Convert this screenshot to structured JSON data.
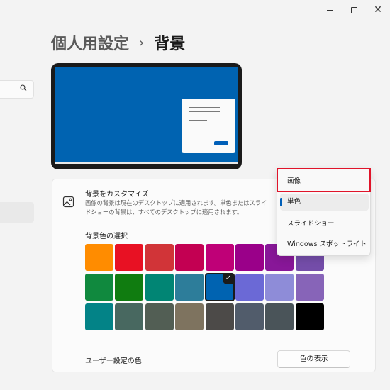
{
  "window": {
    "minimize_label": "",
    "close_glyph": "✕"
  },
  "header": {
    "parent": "個人用設定",
    "separator": "›",
    "current": "背景"
  },
  "customize": {
    "title": "背景をカスタマイズ",
    "description": "画像の背景は現在のデスクトップに適用されます。単色またはスライドショーの背景は、すべてのデスクトップに適用されます。",
    "icon": "image-icon"
  },
  "dropdown": {
    "options": [
      "画像",
      "単色",
      "スライドショー",
      "Windows スポットライト"
    ],
    "selected": "単色",
    "highlighted": "画像"
  },
  "color_picker": {
    "title": "背景色の選択",
    "selected_color": "#0063b1",
    "rows": [
      [
        "#ff8c00",
        "#e81123",
        "#d13438",
        "#c30052",
        "#bf0077",
        "#9a0089",
        "#881798",
        "#744da9"
      ],
      [
        "#10893e",
        "#107c10",
        "#018574",
        "#2d7d9a",
        "#0063b1",
        "#6b69d6",
        "#8e8cd8",
        "#8764b8"
      ],
      [
        "#038387",
        "#486860",
        "#525e54",
        "#7e735f",
        "#4c4a48",
        "#515c6b",
        "#4a5459",
        "#000000"
      ]
    ]
  },
  "custom_color": {
    "label": "ユーザー設定の色",
    "button": "色の表示"
  },
  "colors": {
    "accent": "#005fb8",
    "highlight_border": "#e0142a",
    "preview_desktop": "#0063b1"
  }
}
